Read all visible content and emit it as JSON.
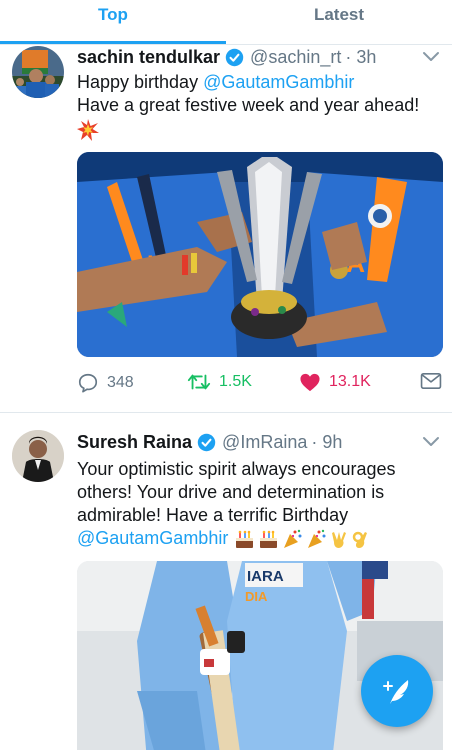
{
  "tabs": [
    {
      "label": "Top",
      "active": true
    },
    {
      "label": "Latest",
      "active": false
    }
  ],
  "tweets": [
    {
      "name": "sachin tendulkar",
      "handle": "@sachin_rt",
      "time": "· 3h",
      "lines": [
        {
          "parts": [
            {
              "text": "Happy birthday "
            },
            {
              "text": "@GautamGambhir",
              "mention": true
            }
          ]
        },
        {
          "parts": [
            {
              "text": "Have a great festive week and year ahead!"
            }
          ]
        }
      ],
      "emoji_icon": "burst-icon",
      "media_desc_icon": "trophy-photo",
      "replies": "348",
      "retweets": "1.5K",
      "likes": "13.1K",
      "liked": true
    },
    {
      "name": "Suresh Raina",
      "handle": "@ImRaina",
      "time": "· 9h",
      "lines": [
        {
          "parts": [
            {
              "text": "Your optimistic spirit always encourages"
            }
          ]
        },
        {
          "parts": [
            {
              "text": "others! Your drive and determination is"
            }
          ]
        },
        {
          "parts": [
            {
              "text": "admirable! Have a terrific Birthday"
            }
          ]
        },
        {
          "parts": [
            {
              "text": "@GautamGambhir",
              "mention": true
            }
          ]
        }
      ],
      "emoji_icons": [
        "cake-icon",
        "cake-icon",
        "party-popper-icon",
        "party-popper-icon",
        "victory-hand-icon",
        "ok-hand-icon"
      ],
      "media_desc_icon": "cricket-photo"
    }
  ],
  "colors": {
    "accent": "#1da1f2",
    "retweet": "#17bf63",
    "like": "#e0245e",
    "secondary_text": "#657786"
  }
}
